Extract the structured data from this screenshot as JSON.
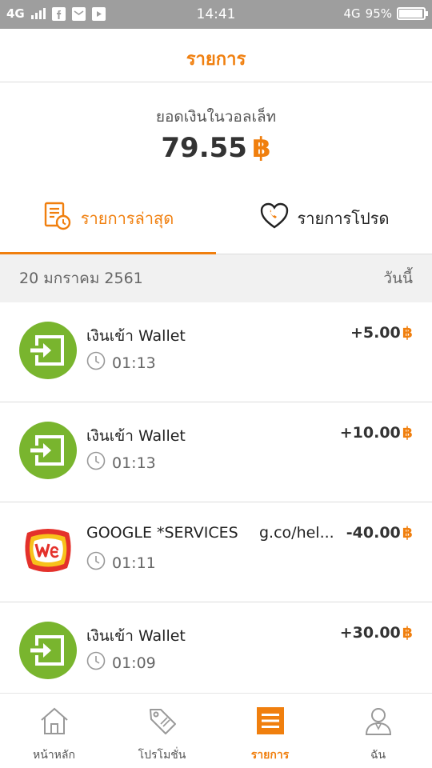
{
  "status_bar": {
    "network_left": "4G",
    "time": "14:41",
    "network_right": "4G",
    "battery": "95%",
    "battery_level": 0.95
  },
  "header": {
    "title": "รายการ"
  },
  "balance": {
    "label": "ยอดเงินในวอลเล็ท",
    "amount": "79.55",
    "currency": "฿"
  },
  "tabs": [
    {
      "label": "รายการล่าสุด",
      "icon": "receipt-clock-icon",
      "active": true
    },
    {
      "label": "รายการโปรด",
      "icon": "heart-phone-icon",
      "active": false
    }
  ],
  "date_header": {
    "date": "20 มกราคม 2561",
    "relative": "วันนี้"
  },
  "transactions": [
    {
      "icon": "wallet-in-icon",
      "title": "เงินเข้า Wallet",
      "merchant": "",
      "time": "01:13",
      "amount": "+5.00",
      "currency": "฿"
    },
    {
      "icon": "wallet-in-icon",
      "title": "เงินเข้า Wallet",
      "merchant": "",
      "time": "01:13",
      "amount": "+10.00",
      "currency": "฿"
    },
    {
      "icon": "we-logo",
      "title": "GOOGLE *SERVICES",
      "merchant": "g.co/hel...",
      "time": "01:11",
      "amount": "-40.00",
      "currency": "฿"
    },
    {
      "icon": "wallet-in-icon",
      "title": "เงินเข้า Wallet",
      "merchant": "",
      "time": "01:09",
      "amount": "+30.00",
      "currency": "฿"
    }
  ],
  "bottom_nav": [
    {
      "label": "หน้าหลัก",
      "icon": "home-icon",
      "active": false
    },
    {
      "label": "โปรโมชั่น",
      "icon": "tag-icon",
      "active": false
    },
    {
      "label": "รายการ",
      "icon": "list-icon",
      "active": true
    },
    {
      "label": "ฉัน",
      "icon": "user-icon",
      "active": false
    }
  ],
  "colors": {
    "accent": "#f07f0e",
    "wallet_green": "#79b52e",
    "status_bar": "#9e9e9e"
  }
}
